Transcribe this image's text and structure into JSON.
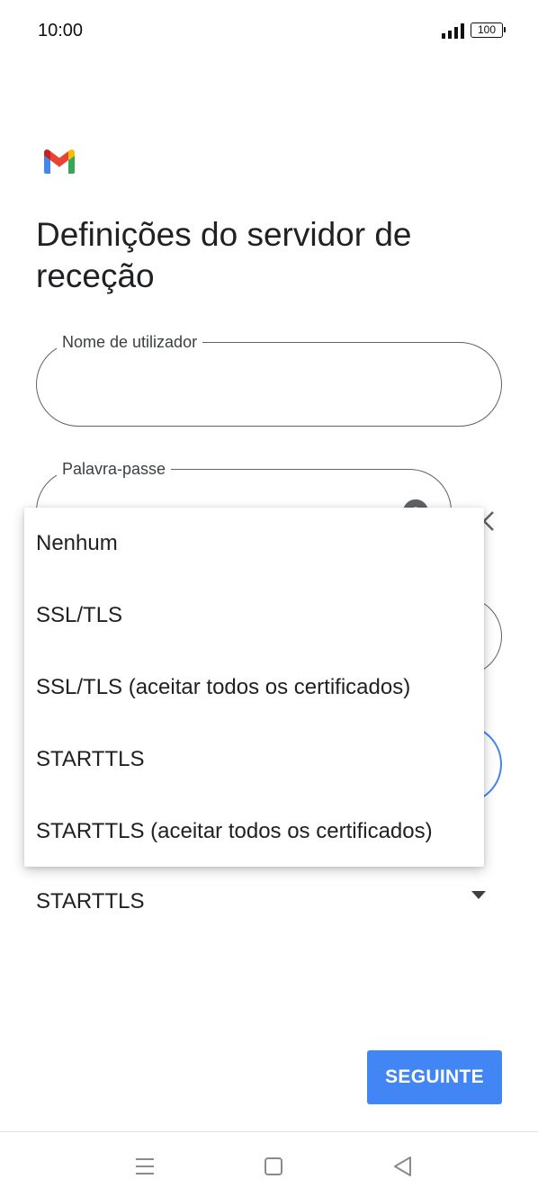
{
  "status_bar": {
    "time": "10:00",
    "battery": "100",
    "icons": [
      "signal-icon",
      "battery-icon"
    ]
  },
  "header": {
    "logo": "gmail-logo-icon",
    "title": "Definições do servidor de receção"
  },
  "form": {
    "username": {
      "label": "Nome de utilizador",
      "value": ""
    },
    "password": {
      "label": "Palavra-passe",
      "value": "",
      "toggle_icon": "eye-icon"
    },
    "security_type": {
      "selected": "STARTTLS",
      "arrow_icon": "arrow-drop-down-icon"
    }
  },
  "dropdown": {
    "options": [
      "Nenhum",
      "SSL/TLS",
      "SSL/TLS (aceitar todos os certificados)",
      "STARTTLS",
      "STARTTLS (aceitar todos os certificados)"
    ]
  },
  "actions": {
    "next_label": "SEGUINTE"
  },
  "navigation": {
    "icons": [
      "menu-icon",
      "home-icon",
      "back-icon"
    ]
  },
  "colors": {
    "accent": "#4285f4",
    "text_primary": "#202124",
    "outline": "#5f6368"
  }
}
